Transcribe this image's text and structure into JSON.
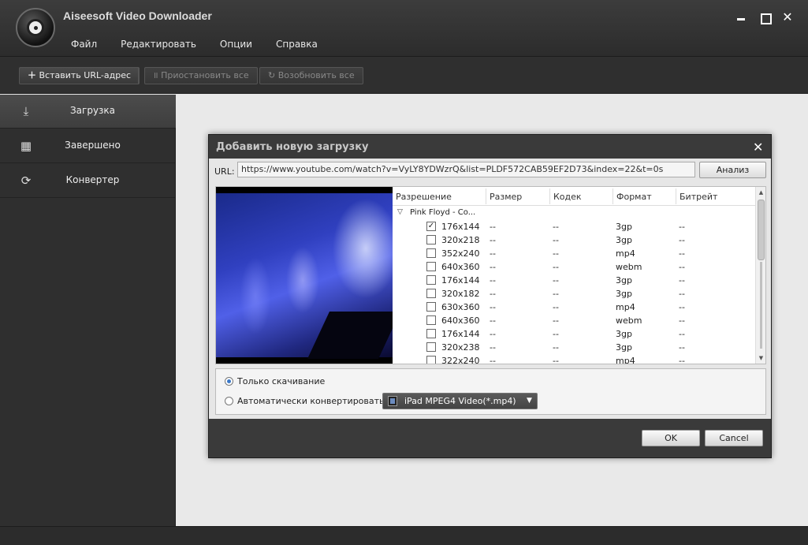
{
  "app": {
    "title": "Aiseesoft Video Downloader",
    "menu": [
      "Файл",
      "Редактировать",
      "Опции",
      "Справка"
    ]
  },
  "toolbar": {
    "paste_url": "Вставить URL-адрес",
    "pause_all": "Приостановить все",
    "resume_all": "Возобновить все"
  },
  "sidebar": {
    "items": [
      {
        "label": "Загрузка",
        "icon": "download-icon",
        "active": true
      },
      {
        "label": "Завершено",
        "icon": "film-done-icon",
        "active": false
      },
      {
        "label": "Конвертер",
        "icon": "convert-icon",
        "active": false
      }
    ]
  },
  "dialog": {
    "title": "Добавить новую загрузку",
    "url_label": "URL:",
    "url_value": "https://www.youtube.com/watch?v=VyLY8YDWzrQ&list=PLDF572CAB59EF2D73&index=22&t=0s",
    "analyze": "Анализ",
    "columns": [
      "Разрешение",
      "Размер",
      "Кодек",
      "Формат",
      "Битрейт"
    ],
    "group_label": "Pink Floyd - Co...",
    "rows": [
      {
        "checked": true,
        "res": "176x144",
        "size": "--",
        "codec": "--",
        "format": "3gp",
        "bitrate": "--"
      },
      {
        "checked": false,
        "res": "320x218",
        "size": "--",
        "codec": "--",
        "format": "3gp",
        "bitrate": "--"
      },
      {
        "checked": false,
        "res": "352x240",
        "size": "--",
        "codec": "--",
        "format": "mp4",
        "bitrate": "--"
      },
      {
        "checked": false,
        "res": "640x360",
        "size": "--",
        "codec": "--",
        "format": "webm",
        "bitrate": "--"
      },
      {
        "checked": false,
        "res": "176x144",
        "size": "--",
        "codec": "--",
        "format": "3gp",
        "bitrate": "--"
      },
      {
        "checked": false,
        "res": "320x182",
        "size": "--",
        "codec": "--",
        "format": "3gp",
        "bitrate": "--"
      },
      {
        "checked": false,
        "res": "630x360",
        "size": "--",
        "codec": "--",
        "format": "mp4",
        "bitrate": "--"
      },
      {
        "checked": false,
        "res": "640x360",
        "size": "--",
        "codec": "--",
        "format": "webm",
        "bitrate": "--"
      },
      {
        "checked": false,
        "res": "176x144",
        "size": "--",
        "codec": "--",
        "format": "3gp",
        "bitrate": "--"
      },
      {
        "checked": false,
        "res": "320x238",
        "size": "--",
        "codec": "--",
        "format": "3gp",
        "bitrate": "--"
      },
      {
        "checked": false,
        "res": "322x240",
        "size": "--",
        "codec": "--",
        "format": "mp4",
        "bitrate": "--"
      }
    ],
    "option_download_only": "Только скачивание",
    "option_auto_convert": "Автоматически конвертировать в:",
    "download_only_selected": true,
    "convert_profile": "iPad MPEG4 Video(*.mp4)",
    "ok": "OK",
    "cancel": "Cancel"
  }
}
